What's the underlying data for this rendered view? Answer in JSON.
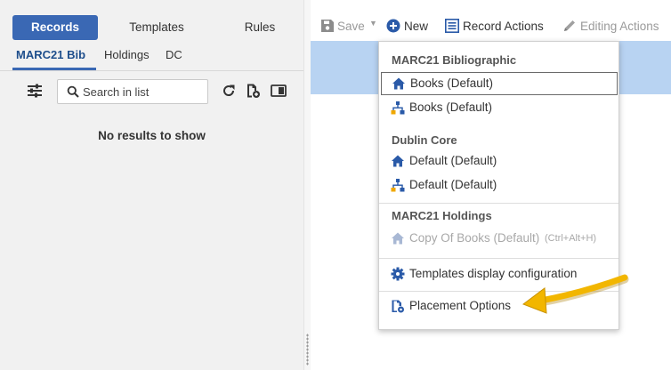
{
  "top_tabs": [
    "Records",
    "Templates",
    "Rules"
  ],
  "sub_tabs": [
    "MARC21 Bib",
    "Holdings",
    "DC"
  ],
  "search": {
    "placeholder": "Search in list"
  },
  "list": {
    "empty_message": "No results to show"
  },
  "actions": {
    "save": "Save",
    "new": "New",
    "record_actions": "Record Actions",
    "editing_actions": "Editing Actions"
  },
  "menu": {
    "sections": [
      {
        "header": "MARC21 Bibliographic",
        "items": [
          {
            "label": "Books (Default)",
            "icon": "home-icon"
          },
          {
            "label": "Books (Default)",
            "icon": "sitemap-icon"
          }
        ]
      },
      {
        "header": "Dublin Core",
        "items": [
          {
            "label": "Default (Default)",
            "icon": "home-icon"
          },
          {
            "label": "Default (Default)",
            "icon": "sitemap-icon"
          }
        ]
      },
      {
        "header": "MARC21 Holdings",
        "items": [
          {
            "label": "Copy Of Books (Default)",
            "icon": "home-icon",
            "shortcut": "(Ctrl+Alt+H)"
          }
        ]
      }
    ],
    "templates_config": "Templates display configuration",
    "placement_options": "Placement Options"
  },
  "colors": {
    "accent": "#3a68b4",
    "selection_strip": "#b8d3f2",
    "arrow": "#f0b400"
  }
}
